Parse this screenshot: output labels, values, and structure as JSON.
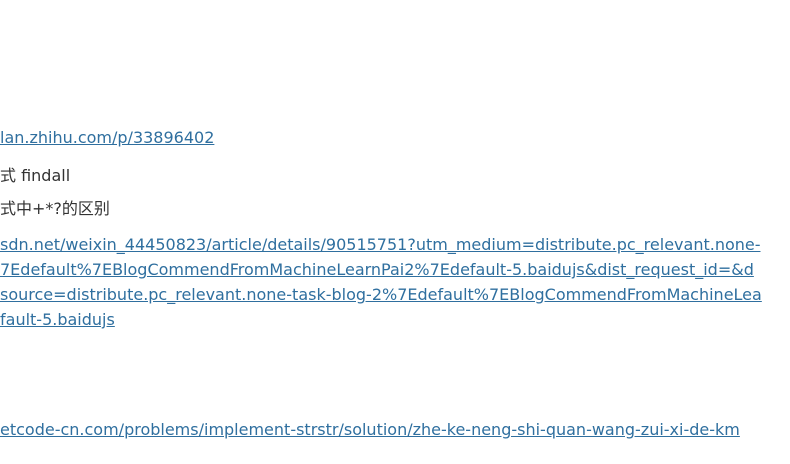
{
  "page": {
    "link_1": "lan.zhihu.com/p/33896402",
    "text_1": "式 findall",
    "text_2": "式中+*?的区别",
    "link_2_lines": [
      "sdn.net/weixin_44450823/article/details/90515751?utm_medium=distribute.pc_relevant.none-",
      "7Edefault%7EBlogCommendFromMachineLearnPai2%7Edefault-5.baidujs&dist_request_id=&d",
      "source=distribute.pc_relevant.none-task-blog-2%7Edefault%7EBlogCommendFromMachineLea",
      "fault-5.baidujs"
    ],
    "link_3": "etcode-cn.com/problems/implement-strstr/solution/zhe-ke-neng-shi-quan-wang-zui-xi-de-km"
  },
  "colors": {
    "text": "#333333",
    "link": "#2f6f9f",
    "background": "#ffffff"
  }
}
